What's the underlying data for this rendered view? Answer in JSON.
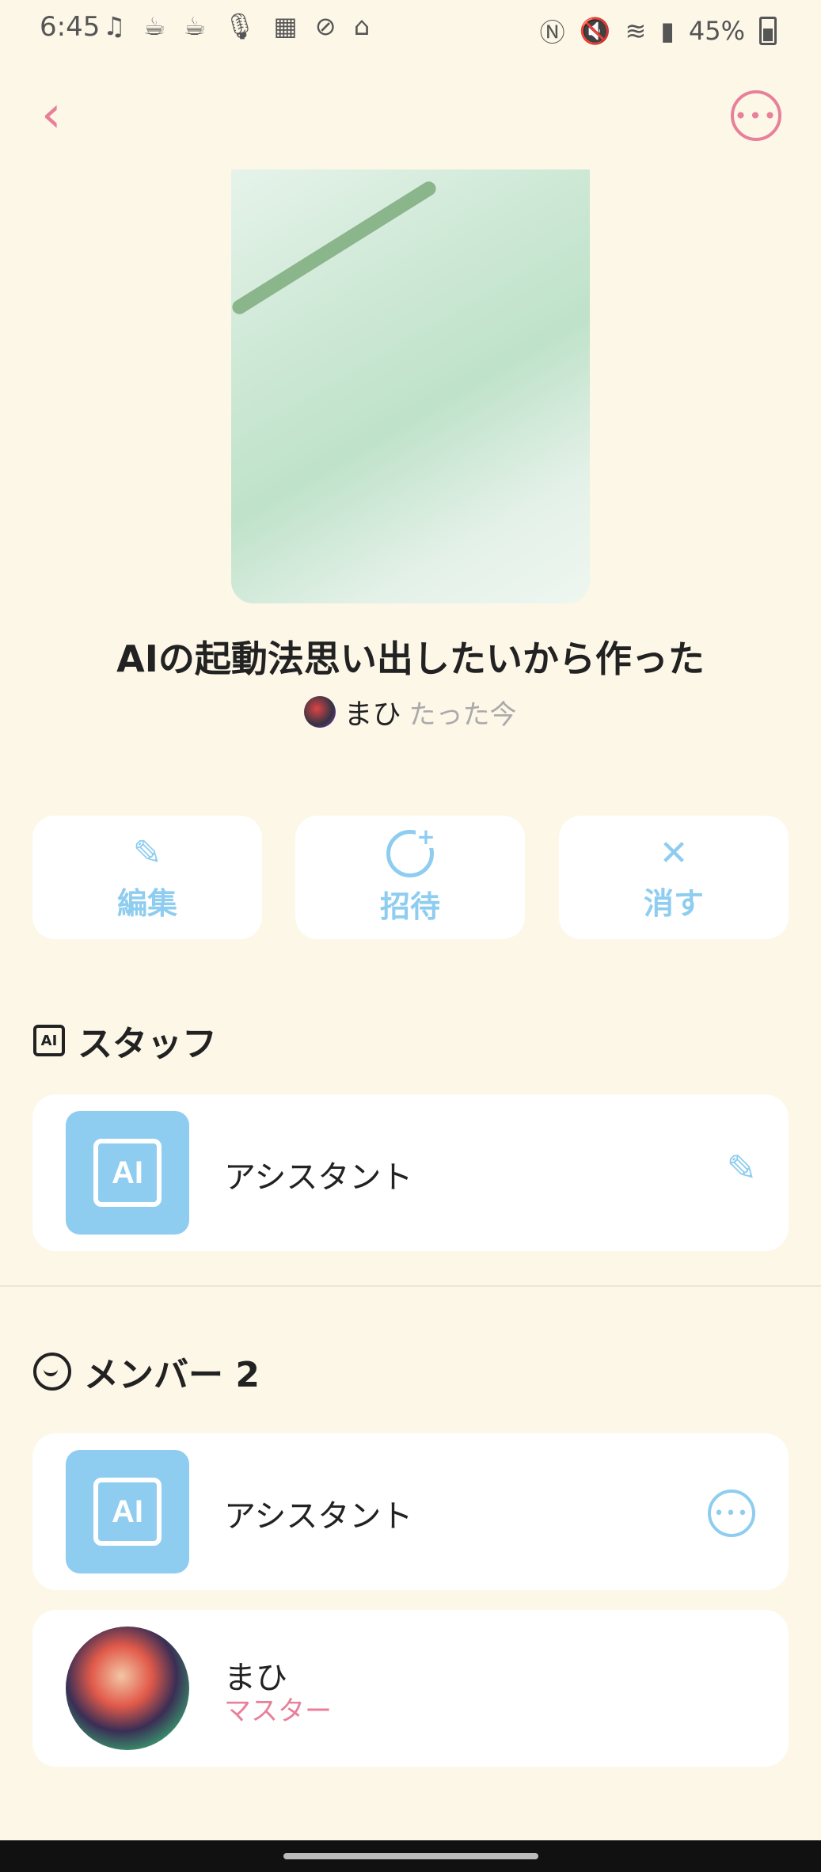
{
  "status_bar": {
    "time": "6:45",
    "left_icons": "♫ ☕ ☕ 🎙 ▦ ⊘ ⌂",
    "battery": "45%"
  },
  "header": {
    "back_icon": "‹",
    "more_icon": "•••"
  },
  "room": {
    "title": "AIの起動法思い出したいから作った",
    "owner_name": "まひ",
    "updated": "たった今"
  },
  "actions": {
    "edit_label": "編集",
    "invite_label": "招待",
    "delete_label": "消す",
    "edit_icon": "✎",
    "delete_icon": "✕"
  },
  "staff_section": {
    "title": "スタッフ",
    "icon_text": "AI",
    "items": [
      {
        "avatar_text": "AI",
        "name": "アシスタント"
      }
    ]
  },
  "member_section": {
    "title": "メンバー 2",
    "items": [
      {
        "avatar_text": "AI",
        "name": "アシスタント"
      },
      {
        "name": "まひ",
        "role": "マスター"
      }
    ]
  },
  "colors": {
    "background": "#fdf7e8",
    "accent_pink": "#e8809a",
    "accent_blue": "#8ecdf0"
  }
}
